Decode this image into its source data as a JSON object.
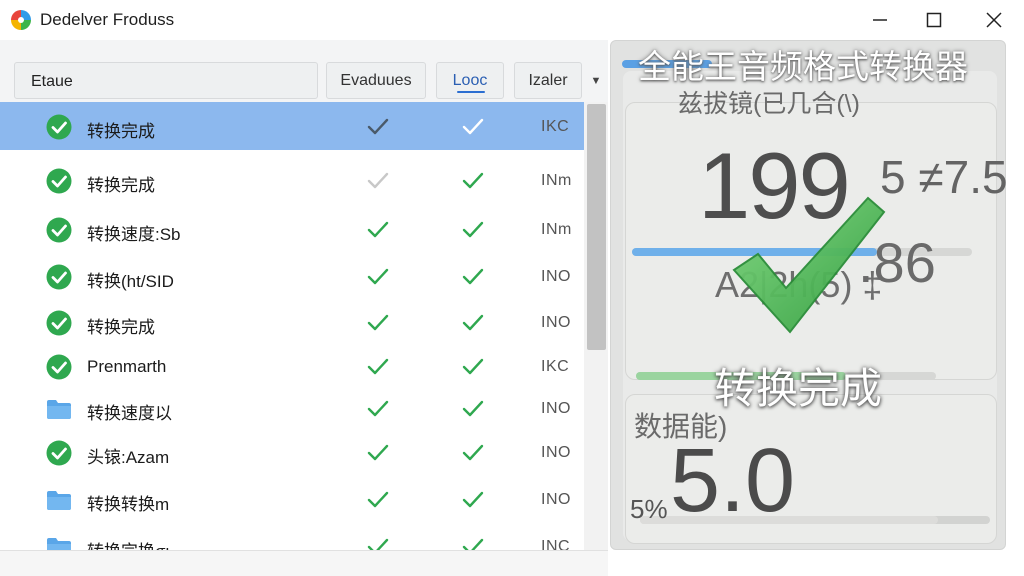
{
  "window": {
    "title": "Dedelver Froduss",
    "controls": {
      "minimize": "minimize-icon",
      "maximize": "maximize-icon",
      "close": "close-icon"
    }
  },
  "toolbar": {
    "search_value": "Etaue",
    "buttons": [
      "Evaduues",
      "Looc",
      "Izaler"
    ],
    "active_button": "Looc"
  },
  "colors": {
    "selection": "#8cb8ee",
    "check_green": "#2fa84f",
    "folder_blue": "#5aa6e8",
    "accent_blue": "#2b6ed1"
  },
  "rows": [
    {
      "icon": "check-circle-icon",
      "name": "转换完成",
      "col1": "check",
      "col2": "check",
      "code": "IKC",
      "selected": true
    },
    {
      "icon": "check-circle-icon",
      "name": "转换完成",
      "col1": "check-faint",
      "col2": "check",
      "code": "INm",
      "selected": false
    },
    {
      "icon": "check-circle-icon",
      "name": "转换速度:Sb",
      "col1": "check",
      "col2": "check",
      "code": "INm",
      "selected": false
    },
    {
      "icon": "check-circle-icon",
      "name": "转换(ht/SID",
      "col1": "check",
      "col2": "check",
      "code": "INO",
      "selected": false
    },
    {
      "icon": "check-circle-icon",
      "name": "转换完成",
      "col1": "check",
      "col2": "check",
      "code": "INO",
      "selected": false
    },
    {
      "icon": "check-circle-icon",
      "name": "Prenmarth",
      "col1": "check",
      "col2": "check",
      "code": "IKC",
      "selected": false
    },
    {
      "icon": "folder-icon",
      "name": "转换速度以",
      "col1": "check",
      "col2": "check",
      "code": "INO",
      "selected": false
    },
    {
      "icon": "check-circle-icon",
      "name": "头锿:Azam",
      "col1": "check",
      "col2": "check",
      "code": "INO",
      "selected": false
    },
    {
      "icon": "folder-icon",
      "name": "转换转换m",
      "col1": "check",
      "col2": "check",
      "code": "INO",
      "selected": false
    },
    {
      "icon": "folder-icon",
      "name": "转换完换σι",
      "col1": "check",
      "col2": "check",
      "code": "INC",
      "selected": false
    }
  ],
  "panel": {
    "heading": "全能王音频格式转换器",
    "label1": "兹拔镜(已几合(\\)",
    "big_value": "199",
    "ratio1": "5 ≠7.5",
    "ratio2a": "A2|2h(5) ‡",
    "ratio2b": ".86",
    "done_label": "转换完成",
    "label3": "数据能)",
    "percent": "5%",
    "big_value2": "5.0",
    "bar1_progress": 0.72,
    "bar2_progress": 0.7,
    "bar3_progress": 0.85
  }
}
